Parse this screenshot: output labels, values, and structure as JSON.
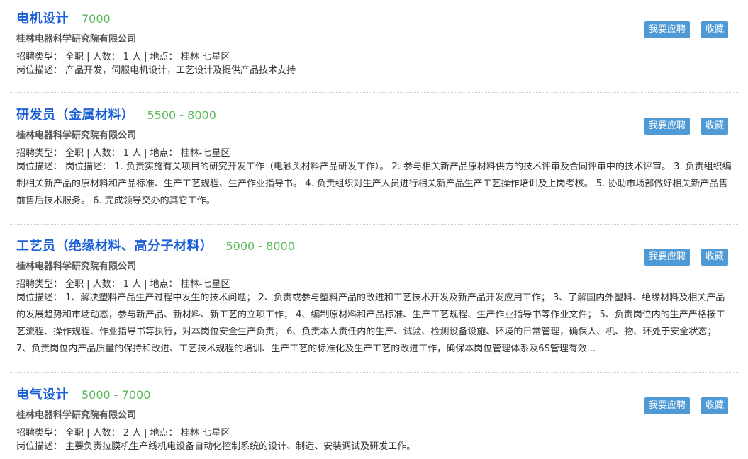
{
  "labels": {
    "type": "招聘类型：",
    "count": "人数：",
    "location": "地点：",
    "desc": "岗位描述：",
    "apply_button": "我要应聘",
    "fav_button": "收藏",
    "separator": "|"
  },
  "jobs": [
    {
      "title": "电机设计",
      "salary": "7000",
      "company": "桂林电器科学研究院有限公司",
      "type": "全职",
      "count": "1 人",
      "location": "桂林-七星区",
      "description": "产品开发，伺服电机设计，工艺设计及提供产品技术支持"
    },
    {
      "title": "研发员（金属材料）",
      "salary": "5500 - 8000",
      "company": "桂林电器科学研究院有限公司",
      "type": "全职",
      "count": "1 人",
      "location": "桂林-七星区",
      "description": "岗位描述： 1. 负责实施有关项目的研究开发工作（电触头材料产品研发工作）。 2. 参与相关新产品原材料供方的技术评审及合同评审中的技术评审。 3. 负责组织编制相关新产品的原材料和产品标准、生产工艺规程、生产作业指导书。 4. 负责组织对生产人员进行相关新产品生产工艺操作培训及上岗考核。 5. 协助市场部做好相关新产品售前售后技术服务。 6. 完成领导交办的其它工作。"
    },
    {
      "title": "工艺员（绝缘材料、高分子材料）",
      "salary": "5000 - 8000",
      "company": "桂林电器科学研究院有限公司",
      "type": "全职",
      "count": "1 人",
      "location": "桂林-七星区",
      "description": "1、解决塑料产品生产过程中发生的技术问题； 2、负责或参与塑料产品的改进和工艺技术开发及新产品开发应用工作； 3、了解国内外塑料、绝缘材料及相关产品的发展趋势和市场动态，参与新产品、新材料、新工艺的立项工作； 4、编制原材料和产品标准、生产工艺规程、生产作业指导书等作业文件； 5、负责岗位内的生产严格按工艺流程、操作规程、作业指导书等执行，对本岗位安全生产负责； 6、负责本人责任内的生产、试验、检测设备设施、环境的日常管理，确保人、机、物、环处于安全状态； 7、负责岗位内产品质量的保持和改进、工艺技术规程的培训、生产工艺的标准化及生产工艺的改进工作，确保本岗位管理体系及6S管理有效..."
    },
    {
      "title": "电气设计",
      "salary": "5000 - 7000",
      "company": "桂林电器科学研究院有限公司",
      "type": "全职",
      "count": "2 人",
      "location": "桂林-七星区",
      "description": "主要负责拉膜机生产线机电设备自动化控制系统的设计、制造、安装调试及研发工作。"
    }
  ],
  "colors": {
    "title": "#1a5fd6",
    "salary": "#5cb85c",
    "button": "#4e9ad6"
  }
}
